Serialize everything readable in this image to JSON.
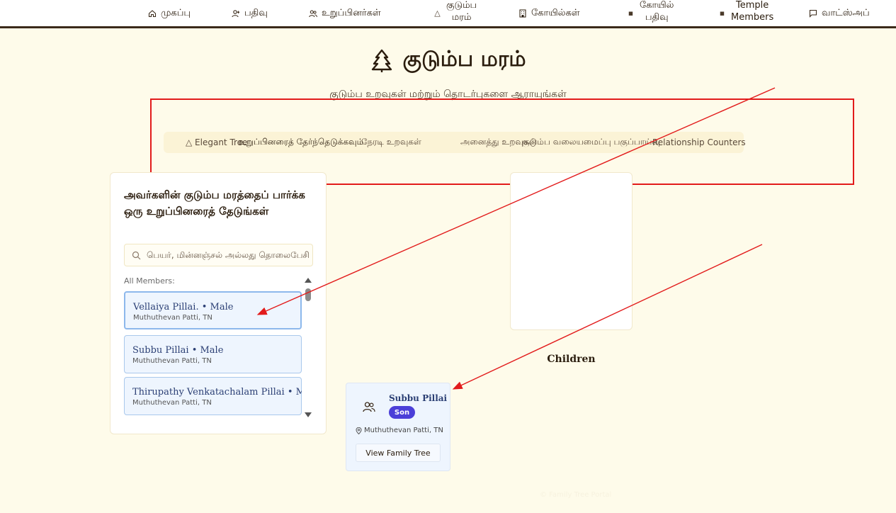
{
  "nav": {
    "items": [
      {
        "label": "முகப்பு",
        "icon": "home-icon"
      },
      {
        "label": "பதிவு",
        "icon": "user-plus-icon"
      },
      {
        "label": "உறுப்பினர்கள்",
        "icon": "users-icon"
      },
      {
        "label_line1": "குடும்ப",
        "label_line2": "மரம்",
        "icon": "tree-icon"
      },
      {
        "label": "கோயில்கள்",
        "icon": "building-icon"
      },
      {
        "label_line1": "கோயில்",
        "label_line2": "பதிவு",
        "icon": "temple-icon"
      },
      {
        "label_line1": "Temple",
        "label_line2": "Members",
        "icon": "temple-icon"
      },
      {
        "label": "வாட்ஸ்அப்",
        "icon": "chat-icon"
      }
    ]
  },
  "page": {
    "title": "குடும்ப மரம்",
    "subtitle": "குடும்ப உறவுகள் மற்றும் தொடர்புகளை ஆராயுங்கள்"
  },
  "tabs": [
    {
      "label": "△ Elegant Tree"
    },
    {
      "label": "உறுப்பினரைத் தேர்ந்தெடுக்கவும்"
    },
    {
      "label": "நேரடி உறவுகள்"
    },
    {
      "label": "அனைத்து உறவுகள்"
    },
    {
      "label": "குடும்ப வலையமைப்பு பகுப்பாய்வு"
    },
    {
      "label": "Relationship Counters"
    }
  ],
  "sidebar": {
    "title": "அவர்களின் குடும்ப மரத்தைப் பார்க்க ஒரு உறுப்பினரைத் தேடுங்கள்",
    "search_placeholder": "பெயர், மின்னஞ்சல் அல்லது தொலைபேசி",
    "all_members_label": "All Members:",
    "members": [
      {
        "name": "Vellaiya Pillai. • Male",
        "location": "Muthuthevan Patti, TN",
        "selected": true
      },
      {
        "name": "Subbu Pillai • Male",
        "location": "Muthuthevan Patti, TN",
        "selected": false
      },
      {
        "name": "Thirupathy Venkatachalam Pillai • Male",
        "location": "Muthuthevan Patti, TN",
        "selected": false
      }
    ]
  },
  "children_section": {
    "heading": "Children",
    "child": {
      "name": "Subbu Pillai",
      "badge": "Son",
      "location": "Muthuthevan Patti, TN",
      "button_label": "View Family Tree"
    }
  },
  "footer": {
    "faint_text": "© Family Tree Portal"
  },
  "colors": {
    "background": "#fefbea",
    "annotation_red": "#e21b1b",
    "badge": "#4b3fd8",
    "member_card": "#eef5fe"
  }
}
